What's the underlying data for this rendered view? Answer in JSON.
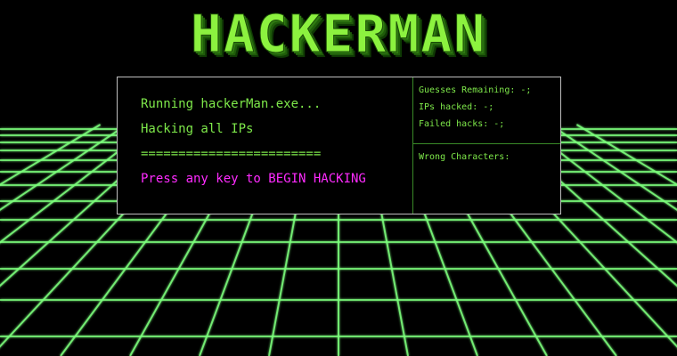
{
  "title": "HACKERMAN",
  "colors": {
    "accent_green": "#7ee84a",
    "logo_green": "#8cf23f",
    "prompt_magenta": "#ff2bff",
    "grid_green": "#7cff7c",
    "background": "#000000"
  },
  "console": {
    "line1": "Running hackerMan.exe...",
    "line2": "Hacking all IPs",
    "divider": "========================",
    "prompt": "Press any key to BEGIN HACKING"
  },
  "stats": {
    "guesses_remaining": "Guesses Remaining: -;",
    "ips_hacked": "IPs hacked: -;",
    "failed_hacks": "Failed hacks: -;",
    "wrong_characters": "Wrong Characters:"
  }
}
